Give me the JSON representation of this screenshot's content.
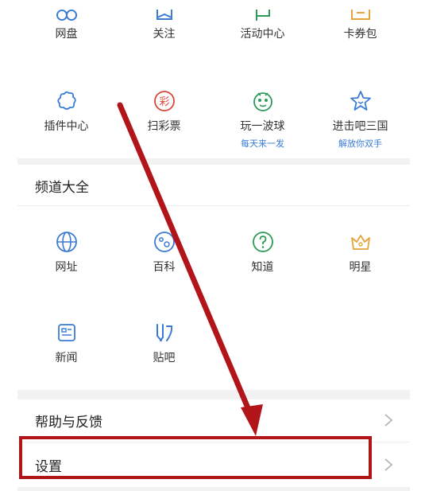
{
  "top_row": [
    {
      "label": "网盘",
      "icon": "cloud-drive-icon",
      "color": "#3a7bd5"
    },
    {
      "label": "关注",
      "icon": "follow-icon",
      "color": "#3a7bd5"
    },
    {
      "label": "活动中心",
      "icon": "flag-icon",
      "color": "#2e9a5a"
    },
    {
      "label": "卡券包",
      "icon": "coupon-icon",
      "color": "#e5a43a"
    }
  ],
  "second_row": [
    {
      "label": "插件中心",
      "icon": "plugin-icon",
      "color": "#3a7bd5",
      "sub": ""
    },
    {
      "label": "扫彩票",
      "icon": "lottery-icon",
      "color": "#d9473a",
      "sub": ""
    },
    {
      "label": "玩一波球",
      "icon": "ball-game-icon",
      "color": "#2e9a5a",
      "sub": "每天来一发"
    },
    {
      "label": "进击吧三国",
      "icon": "star-game-icon",
      "color": "#3a7bd5",
      "sub": "解放你双手"
    }
  ],
  "channels": {
    "title": "频道大全",
    "row1": [
      {
        "label": "网址",
        "icon": "globe-icon",
        "color": "#3a7bd5"
      },
      {
        "label": "百科",
        "icon": "encyclopedia-icon",
        "color": "#3a7bd5"
      },
      {
        "label": "知道",
        "icon": "question-icon",
        "color": "#2e9a5a"
      },
      {
        "label": "明星",
        "icon": "crown-icon",
        "color": "#e5a43a"
      }
    ],
    "row2": [
      {
        "label": "新闻",
        "icon": "news-icon",
        "color": "#3a7bd5"
      },
      {
        "label": "贴吧",
        "icon": "tieba-icon",
        "color": "#3a7bd5"
      }
    ]
  },
  "list": {
    "help": "帮助与反馈",
    "settings": "设置"
  },
  "colors": {
    "sub_text": "#3a7bd5",
    "annotation": "#b11419"
  }
}
